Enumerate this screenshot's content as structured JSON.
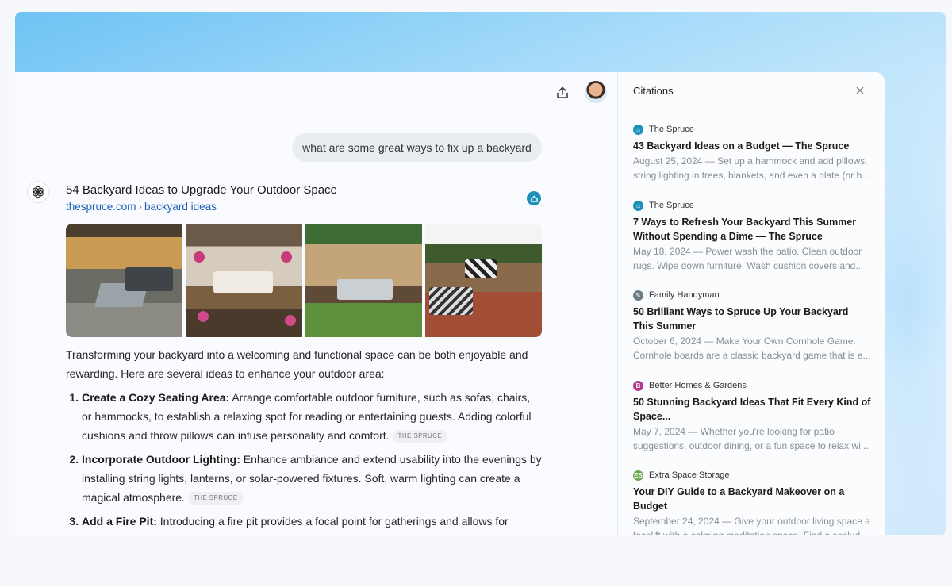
{
  "user_message": "what are some great ways to fix up a backyard",
  "result": {
    "title": "54 Backyard Ideas to Upgrade Your Outdoor Space",
    "domain": "thespruce.com",
    "path": "backyard ideas",
    "images": [
      "Backyard seating area with fire pit",
      "Pergola with hanging flowers",
      "Deck with outdoor sofa",
      "Patio with pallet furniture"
    ]
  },
  "answer": {
    "intro": "Transforming your backyard into a welcoming and functional space can be both enjoyable and rewarding. Here are several ideas to enhance your outdoor area:",
    "items": [
      {
        "heading": "Create a Cozy Seating Area:",
        "text": " Arrange comfortable outdoor furniture, such as sofas, chairs, or hammocks, to establish a relaxing spot for reading or entertaining guests. Adding colorful cushions and throw pillows can infuse personality and comfort.",
        "cite": "THE SPRUCE"
      },
      {
        "heading": "Incorporate Outdoor Lighting:",
        "text": " Enhance ambiance and extend usability into the evenings by installing string lights, lanterns, or solar-powered fixtures. Soft, warm lighting can create a magical atmosphere.",
        "cite": "THE SPRUCE"
      },
      {
        "heading": "Add a Fire Pit:",
        "text": " Introducing a fire pit provides a focal point for gatherings and allows for enjoyable",
        "cite": ""
      }
    ]
  },
  "citations": {
    "header": "Citations",
    "items": [
      {
        "source": "The Spruce",
        "fav_color": "#1b90b9",
        "fav_glyph": "⌂",
        "title": "43 Backyard Ideas on a Budget — The Spruce",
        "snippet": "August 25, 2024 — Set up a hammock and add pillows, string lighting in trees, blankets, and even a plate (or b..."
      },
      {
        "source": "The Spruce",
        "fav_color": "#1b90b9",
        "fav_glyph": "⌂",
        "title": "7 Ways to Refresh Your Backyard This Summer Without Spending a Dime — The Spruce",
        "snippet": "May 18, 2024 — Power wash the patio. Clean outdoor rugs. Wipe down furniture. Wash cushion covers and..."
      },
      {
        "source": "Family Handyman",
        "fav_color": "#6b7c86",
        "fav_glyph": "✎",
        "title": "50 Brilliant Ways to Spruce Up Your Backyard This Summer",
        "snippet": "October 6, 2024 — Make Your Own Cornhole Game. Cornhole boards are a classic backyard game that is e..."
      },
      {
        "source": "Better Homes & Gardens",
        "fav_color": "#b23a8e",
        "fav_glyph": "B",
        "title": "50 Stunning Backyard Ideas That Fit Every Kind of Space...",
        "snippet": "May 7, 2024 — Whether you're looking for patio suggestions, outdoor dining, or a fun space to relax wi..."
      },
      {
        "source": "Extra Space Storage",
        "fav_color": "#6aa84f",
        "fav_glyph": "ES",
        "title": "Your DIY Guide to a Backyard Makeover on a Budget",
        "snippet": "September 24, 2024 — Give your outdoor living space a facelift with a calming meditation space. Find a seclud..."
      }
    ]
  }
}
